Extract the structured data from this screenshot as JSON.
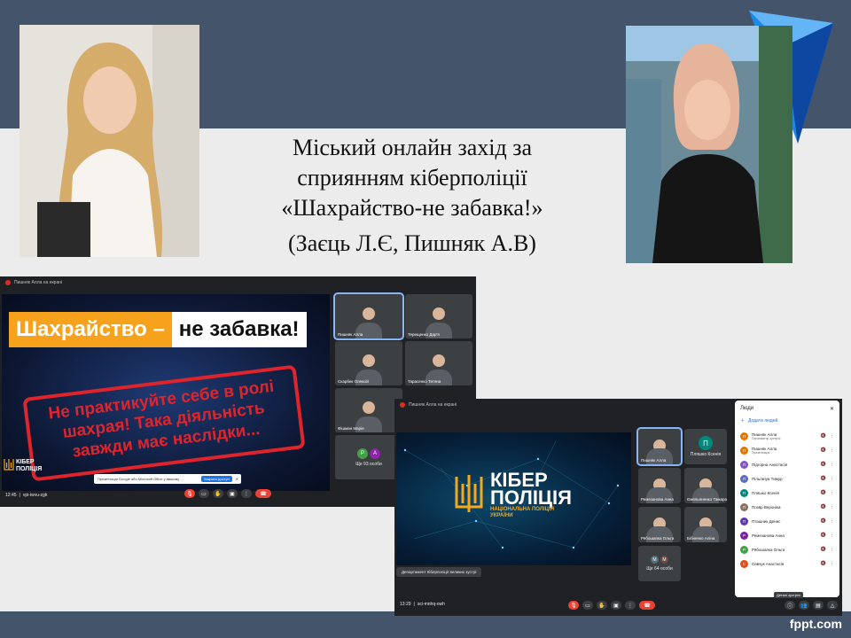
{
  "slide": {
    "title_lines": [
      "Міський онлайн захід за",
      "сприянням кіберполіції",
      "«Шахрайство-не забавка!»"
    ],
    "authors": "(Заєць Л.Є, Пишняк А.В)",
    "brand": "fppt.com",
    "colors": {
      "band": "#44556b",
      "background": "#ececec"
    }
  },
  "meet1": {
    "top_label": "Пишняк Алла на екрані",
    "headline_part1": "Шахрайство –",
    "headline_part2": "не забавка!",
    "warning": "Не практикуйте себе в ролі шахрая! Така діяльність завжди має наслідки...",
    "logo_text": "КІБЕР\nПОЛІЦІЯ",
    "notice_text": "Презентація Google або Microsoft Office у вашому ...",
    "notice_button": "Закрити доступ",
    "time": "12:45",
    "code": "vpi-iwvu-zgk",
    "tiles": [
      {
        "name": "Пишняк Алла"
      },
      {
        "name": "Терещенко Дар'я"
      },
      {
        "name": "Скарбек Олексій"
      },
      {
        "name": "Тарасенко Тетяна"
      },
      {
        "name": "Фішман Марія"
      }
    ],
    "others": {
      "label": "Ще 93 особи",
      "avatars": [
        "Р",
        "А"
      ]
    }
  },
  "meet2": {
    "top_label": "Пишняк Алла на екрані",
    "logo_main": "КІБЕР\nПОЛІЦІЯ",
    "logo_sub": "НАЦІОНАЛЬНА ПОЛІЦІЯ\nУКРАЇНИ",
    "dept_label": "Департамент Кіберполіції великих зустрі",
    "time": "13:29",
    "code": "sci-mnhq-owh",
    "tiles": [
      {
        "name": "Пишняк Алла"
      },
      {
        "name": "Пляшко Ксенія",
        "initial": "П"
      },
      {
        "name": "Ремезанова Анна"
      },
      {
        "name": "Ємельяненко Тамара"
      },
      {
        "name": "Рябошапка Ольга"
      },
      {
        "name": "Бібненко Аліна"
      }
    ],
    "others": {
      "label": "Ще 64 особи",
      "avatars": [
        "М",
        "М"
      ]
    },
    "people_panel": {
      "title": "Люди",
      "add_label": "Додати людей",
      "tooltip": "Деталі зустрічі",
      "people": [
        {
          "initial": "П",
          "name": "Пишняк Алла",
          "sub": "Організатор зустрічі",
          "color": "#e37400"
        },
        {
          "initial": "П",
          "name": "Пишняк Алла",
          "sub": "Презентація",
          "color": "#e37400"
        },
        {
          "initial": "П",
          "name": "Підгорна Анастасія",
          "sub": "",
          "color": "#7e57c2"
        },
        {
          "initial": "П",
          "name": "Пільгануа Тимур",
          "sub": "",
          "color": "#5c6bc0"
        },
        {
          "initial": "П",
          "name": "Пляшко Ксенія",
          "sub": "",
          "color": "#00897b"
        },
        {
          "initial": "П",
          "name": "Позвр Вероніка",
          "sub": "",
          "color": "#8d6e63"
        },
        {
          "initial": "П",
          "name": "Пташник Денис",
          "sub": "",
          "color": "#5e35b1"
        },
        {
          "initial": "Р",
          "name": "Ремезанова Анна",
          "sub": "",
          "color": "#7b1fa2"
        },
        {
          "initial": "Р",
          "name": "Рябошапка Ольга",
          "sub": "",
          "color": "#43a047"
        },
        {
          "initial": "С",
          "name": "Савчук Анастасія",
          "sub": "",
          "color": "#e64a19"
        }
      ]
    }
  }
}
